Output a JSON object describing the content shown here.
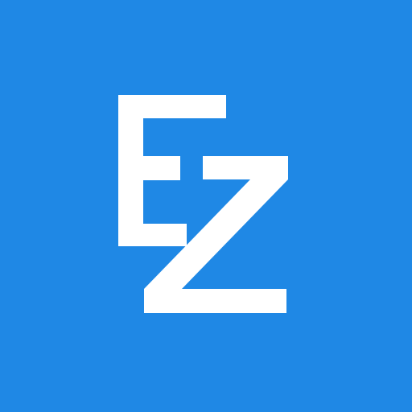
{
  "app_icon": {
    "background_color": "#1f88e5",
    "logo_color": "#ffffff",
    "logo_letters": "EZ",
    "logo_icon": "ez-monogram-icon"
  }
}
